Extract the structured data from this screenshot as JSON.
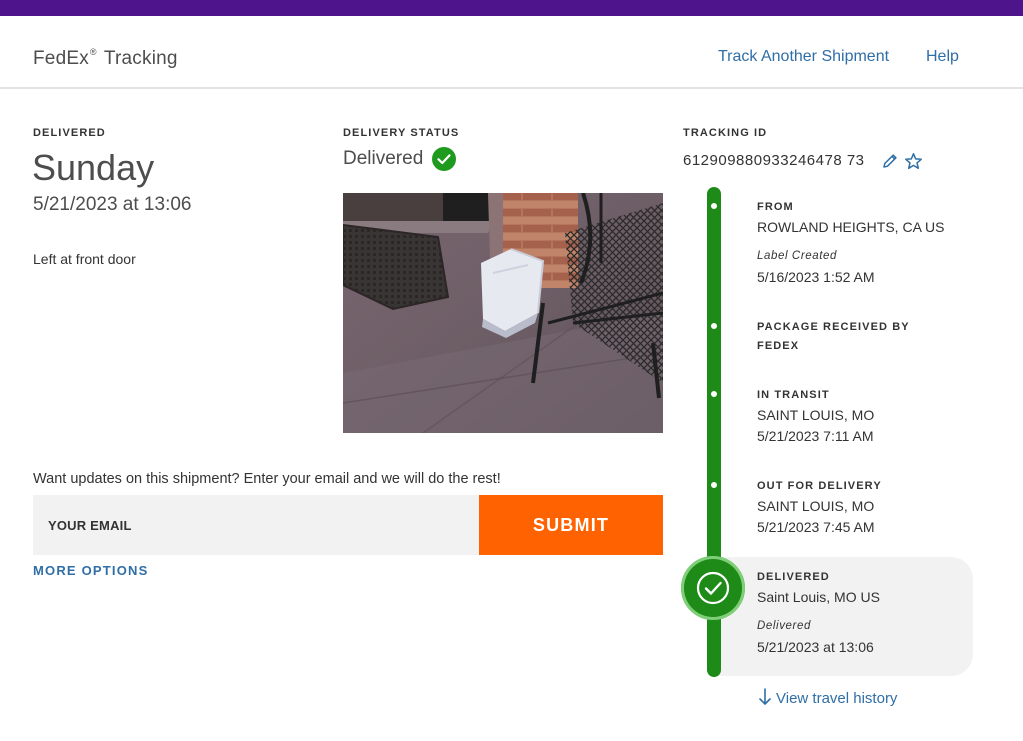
{
  "header": {
    "brand_name": "FedEx",
    "brand_mark": "®",
    "brand_suffix": "Tracking",
    "track_another": "Track Another Shipment",
    "help": "Help"
  },
  "summary": {
    "delivered_label": "DELIVERED",
    "day": "Sunday",
    "datetime": "5/21/2023 at 13:06",
    "note": "Left at front door"
  },
  "status": {
    "label": "DELIVERY STATUS",
    "value": "Delivered"
  },
  "tracking": {
    "label": "TRACKING ID",
    "number": "612909880933246478 73"
  },
  "updates": {
    "prompt": "Want updates on this shipment? Enter your email and we will do the rest!",
    "email_placeholder": "YOUR EMAIL",
    "submit_label": "SUBMIT",
    "more_options": "MORE OPTIONS"
  },
  "timeline": {
    "from": {
      "title": "FROM",
      "location": "ROWLAND HEIGHTS, CA US",
      "event": "Label Created",
      "time": "5/16/2023 1:52 AM"
    },
    "received": {
      "title_line1": "PACKAGE RECEIVED BY",
      "title_line2": "FEDEX"
    },
    "in_transit": {
      "title": "IN TRANSIT",
      "location": "SAINT LOUIS, MO",
      "time": "5/21/2023 7:11 AM"
    },
    "out_for_delivery": {
      "title": "OUT FOR DELIVERY",
      "location": "SAINT LOUIS, MO",
      "time": "5/21/2023 7:45 AM"
    },
    "delivered": {
      "title": "DELIVERED",
      "location": "Saint Louis, MO US",
      "event": "Delivered",
      "time": "5/21/2023 at 13:06"
    }
  },
  "travel_history": "View travel history",
  "colors": {
    "brand_purple": "#4d148c",
    "accent_orange": "#ff6200",
    "success_green": "#1e8a18",
    "link_blue": "#2f6ea6"
  },
  "icons": {
    "status": "check-circle-icon",
    "edit": "pencil-icon",
    "favorite": "star-icon",
    "delivered": "check-circle-icon",
    "history": "arrow-down-icon"
  }
}
